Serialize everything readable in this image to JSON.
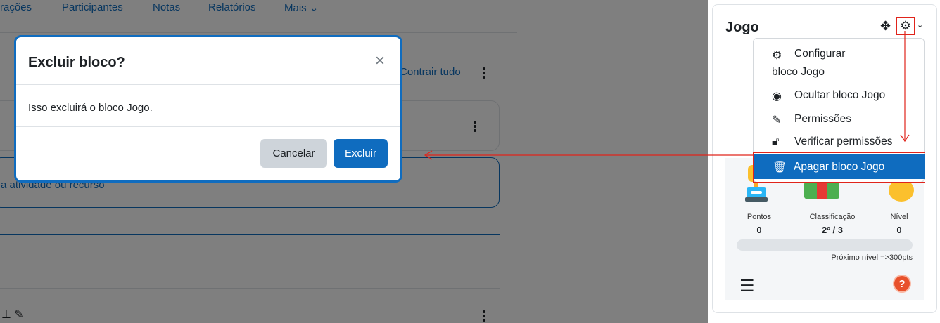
{
  "nav": {
    "items": [
      "rações",
      "Participantes",
      "Notas",
      "Relatórios",
      "Mais"
    ]
  },
  "course": {
    "collapse_all": "Contrair tudo",
    "add_activity": "a atividade ou recurso"
  },
  "block": {
    "title": "Jogo",
    "stats": [
      {
        "label": "Pontos",
        "value": "0"
      },
      {
        "label": "Classificação",
        "value": "2º / 3"
      },
      {
        "label": "Nível",
        "value": "0"
      }
    ],
    "progress_fraction": 0,
    "next_level": "Próximo nível =>300pts"
  },
  "menu": {
    "items": [
      {
        "icon": "gear-icon",
        "label": "Configurar bloco Jogo"
      },
      {
        "icon": "eye-icon",
        "label": "Ocultar bloco Jogo"
      },
      {
        "icon": "edit-icon",
        "label": "Permissões"
      },
      {
        "icon": "unlock-icon",
        "label": "Verificar permissões"
      },
      {
        "icon": "trash-icon",
        "label": "Apagar bloco Jogo"
      }
    ]
  },
  "modal": {
    "title": "Excluir bloco?",
    "close": "×",
    "body": "Isso excluirá o bloco Jogo.",
    "cancel_label": "Cancelar",
    "delete_label": "Excluir"
  },
  "colors": {
    "primary": "#0f6cbf",
    "annotation": "#e0241b"
  }
}
